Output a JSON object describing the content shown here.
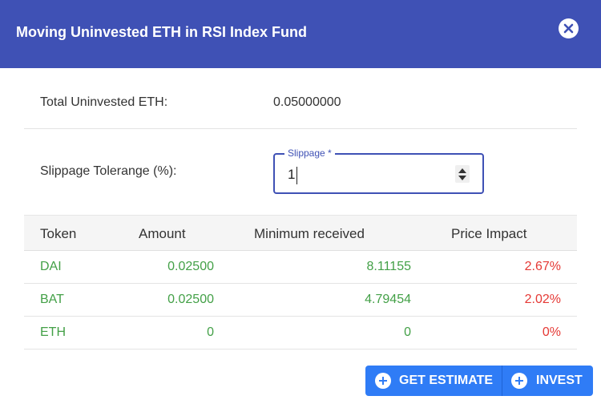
{
  "dialog": {
    "title": "Moving Uninvested ETH in RSI Index Fund",
    "close_icon": "close-icon"
  },
  "summary": {
    "uninvested_label": "Total Uninvested ETH:",
    "uninvested_value": "0.05000000",
    "slippage_label": "Slippage Tolerange (%):"
  },
  "slippage": {
    "legend": "Slippage *",
    "value": "1"
  },
  "table": {
    "headers": [
      "Token",
      "Amount",
      "Minimum received",
      "Price Impact"
    ],
    "rows": [
      {
        "token": "DAI",
        "amount": "0.02500",
        "min_received": "8.11155",
        "price_impact": "2.67%"
      },
      {
        "token": "BAT",
        "amount": "0.02500",
        "min_received": "4.79454",
        "price_impact": "2.02%"
      },
      {
        "token": "ETH",
        "amount": "0",
        "min_received": "0",
        "price_impact": "0%"
      }
    ]
  },
  "actions": {
    "estimate_label": "GET ESTIMATE",
    "invest_label": "INVEST",
    "icon": "plus-circle-icon"
  },
  "colors": {
    "header": "#3f51b5",
    "positive": "#43a047",
    "negative": "#e53935",
    "button": "#2f7cf6"
  }
}
